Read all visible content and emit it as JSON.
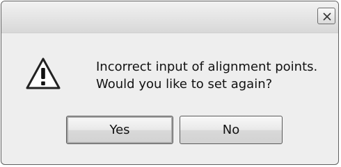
{
  "dialog": {
    "title": "",
    "message_line1": "Incorrect input of alignment points.",
    "message_line2": "Would you like to set again?",
    "icon": "warning-icon",
    "close_icon": "close-icon"
  },
  "buttons": {
    "yes_label": "Yes",
    "no_label": "No"
  },
  "colors": {
    "background": "#eeeeee",
    "title_bar": "#e3e3e3",
    "border": "#5f5f5f",
    "icon_fill": "#ffffff",
    "icon_outline": "#222222"
  }
}
